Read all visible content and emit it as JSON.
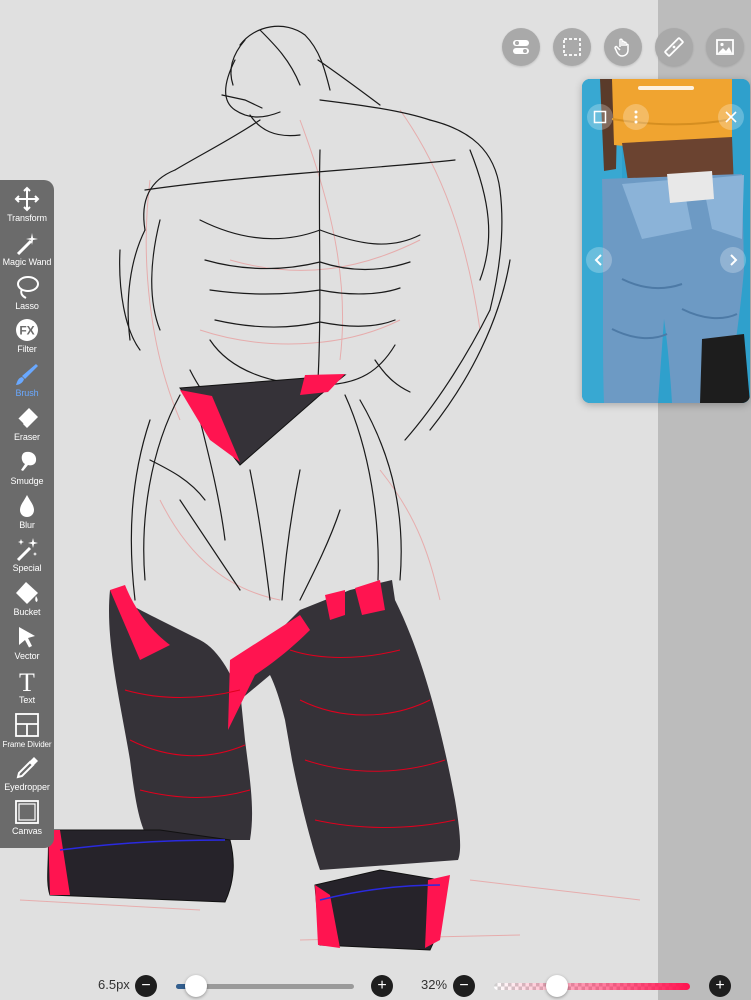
{
  "app": {
    "accent_color": "#69a8ff",
    "brush_color": "#ff1450"
  },
  "toolbar": {
    "active": "brush",
    "items": [
      {
        "id": "transform",
        "label": "Transform",
        "icon": "transform-icon"
      },
      {
        "id": "magic-wand",
        "label": "Magic Wand",
        "icon": "magic-wand-icon"
      },
      {
        "id": "lasso",
        "label": "Lasso",
        "icon": "lasso-icon"
      },
      {
        "id": "filter",
        "label": "Filter",
        "icon": "fx-icon"
      },
      {
        "id": "brush",
        "label": "Brush",
        "icon": "brush-icon"
      },
      {
        "id": "eraser",
        "label": "Eraser",
        "icon": "eraser-icon"
      },
      {
        "id": "smudge",
        "label": "Smudge",
        "icon": "smudge-icon"
      },
      {
        "id": "blur",
        "label": "Blur",
        "icon": "blur-drop-icon"
      },
      {
        "id": "special",
        "label": "Special",
        "icon": "sparkle-icon"
      },
      {
        "id": "bucket",
        "label": "Bucket",
        "icon": "bucket-icon"
      },
      {
        "id": "vector",
        "label": "Vector",
        "icon": "vector-arrow-icon"
      },
      {
        "id": "text",
        "label": "Text",
        "icon": "text-icon"
      },
      {
        "id": "frame-divider",
        "label": "Frame Divider",
        "icon": "frame-divider-icon"
      },
      {
        "id": "eyedropper",
        "label": "Eyedropper",
        "icon": "eyedropper-icon"
      },
      {
        "id": "canvas",
        "label": "Canvas",
        "icon": "canvas-icon"
      }
    ],
    "filter_glyph": "FX",
    "text_glyph": "T"
  },
  "top_buttons": [
    {
      "id": "settings-toggle",
      "icon": "toggle-icon"
    },
    {
      "id": "selection",
      "icon": "selection-icon"
    },
    {
      "id": "gesture",
      "icon": "hand-icon"
    },
    {
      "id": "ruler",
      "icon": "ruler-icon"
    },
    {
      "id": "reference",
      "icon": "image-icon"
    }
  ],
  "reference_window": {
    "controls": [
      "window-mode-icon",
      "more-icon",
      "close-icon",
      "previous-icon",
      "next-icon"
    ]
  },
  "bottom_bar": {
    "brush_size": "6.5px",
    "brush_size_fraction": 0.11,
    "opacity": "32%",
    "opacity_fraction": 0.32,
    "minus_glyph": "−",
    "plus_glyph": "+"
  }
}
